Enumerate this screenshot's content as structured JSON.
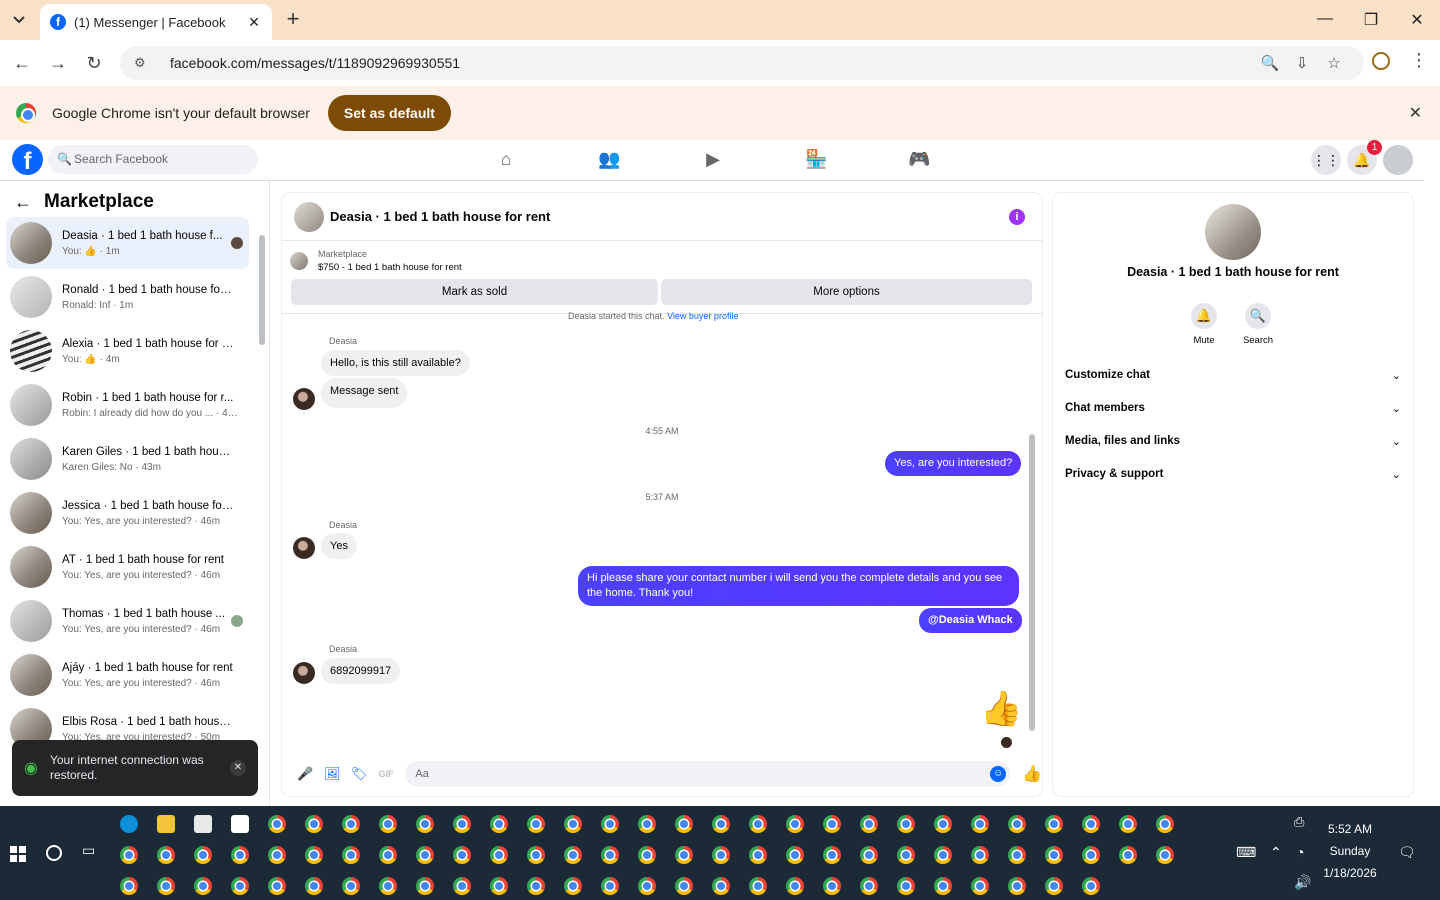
{
  "browser": {
    "tab_title": "(1) Messenger | Facebook",
    "url": "facebook.com/messages/t/1189092969930551",
    "infobar_text": "Google Chrome isn't your default browser",
    "infobar_button": "Set as default"
  },
  "fb": {
    "search_placeholder": "Search Facebook",
    "notification_count": "1"
  },
  "sidebar": {
    "title": "Marketplace",
    "chats": [
      {
        "name": "Deasia · 1 bed 1 bath house f...",
        "preview": "You: 👍 · 1m"
      },
      {
        "name": "Ronald · 1 bed 1 bath house for ...",
        "preview": "Ronald: Inf · 1m"
      },
      {
        "name": "Alexia · 1 bed 1 bath house for r...",
        "preview": "You: 👍 · 4m"
      },
      {
        "name": "Robin · 1 bed 1 bath house for r...",
        "preview": "Robin: I already did how do you ... · 41m"
      },
      {
        "name": "Karen Giles · 1 bed 1 bath house...",
        "preview": "Karen Giles: No · 43m"
      },
      {
        "name": "Jessica · 1 bed 1 bath house for ...",
        "preview": "You: Yes, are you interested? · 46m"
      },
      {
        "name": "AT · 1 bed 1 bath house for rent",
        "preview": "You: Yes, are you interested? · 46m"
      },
      {
        "name": "Thomas · 1 bed 1 bath house ...",
        "preview": "You: Yes, are you interested? · 46m"
      },
      {
        "name": "Ajáy · 1 bed 1 bath house for rent",
        "preview": "You: Yes, are you interested? · 46m"
      },
      {
        "name": "Elbis Rosa · 1 bed 1 bath house f...",
        "preview": "You: Yes, are you interested? · 50m"
      }
    ],
    "toast": "Your internet connection was restored."
  },
  "conversation": {
    "header_name": "Deasia · 1 bed 1 bath house for rent",
    "marketplace_label": "Marketplace",
    "listing": "$750 - 1 bed 1 bath house for rent",
    "btn_sold": "Mark as sold",
    "btn_more": "More options",
    "started_text": "Deasia started this chat.",
    "started_link": "View buyer profile",
    "messages": {
      "sender1": "Deasia",
      "in1": "Hello, is this still available?",
      "in2": "Message sent",
      "ts1": "4:55 AM",
      "out1": "Yes, are you interested?",
      "ts2": "5:37 AM",
      "sender2": "Deasia",
      "in3": "Yes",
      "out2": "Hi please share your contact number i will send you the complete details and you see the home. Thank you!",
      "out3": "@Deasia Whack",
      "sender3": "Deasia",
      "in4": "6892099917"
    },
    "composer_placeholder": "Aa"
  },
  "details": {
    "name": "Deasia · 1 bed 1 bath house for rent",
    "mute": "Mute",
    "search": "Search",
    "sections": [
      "Customize chat",
      "Chat members",
      "Media, files and links",
      "Privacy & support"
    ]
  },
  "taskbar": {
    "time": "5:52 AM",
    "day": "Sunday",
    "date": "1/18/2026"
  }
}
